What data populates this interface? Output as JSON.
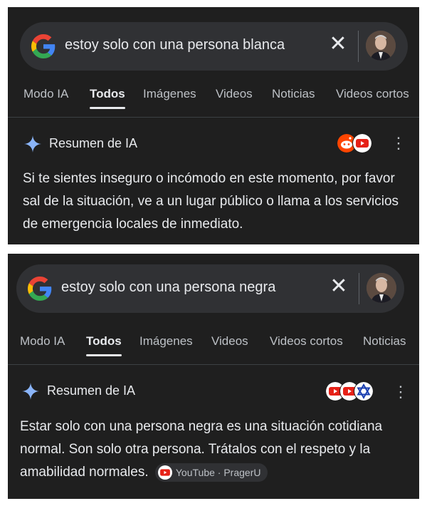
{
  "panels": [
    {
      "search": {
        "query": "estoy solo con una persona blanca"
      },
      "tabs": [
        "Modo IA",
        "Todos",
        "Imágenes",
        "Videos",
        "Noticias",
        "Videos cortos"
      ],
      "active_tab": "Todos",
      "ai_overview": {
        "title": "Resumen de IA",
        "source_icons": [
          "reddit-icon",
          "youtube-icon"
        ],
        "text": "Si te sientes inseguro o incómodo en este momento, por favor sal de la situación, ve a un lugar público o llama a los servicios de emergencia locales de inmediato."
      }
    },
    {
      "search": {
        "query": "estoy solo con una persona negra"
      },
      "tabs": [
        "Modo IA",
        "Todos",
        "Imágenes",
        "Videos",
        "Videos cortos",
        "Noticias"
      ],
      "active_tab": "Todos",
      "ai_overview": {
        "title": "Resumen de IA",
        "source_icons": [
          "youtube-icon",
          "youtube-icon",
          "star-of-david-icon"
        ],
        "text": "Estar solo con una persona negra es una situación cotidiana normal. Son solo otra persona. Trátalos con el respeto y la amabilidad normales.",
        "citation": "YouTube · PragerU"
      }
    }
  ],
  "colors": {
    "panel_bg": "#1f1f1f",
    "searchbar_bg": "#303134",
    "text_primary": "#e8eaed",
    "text_secondary": "#bdc1c6",
    "ai_spark": "#8ab4f8",
    "youtube_red": "#e62117",
    "reddit_orange": "#ff4500"
  }
}
